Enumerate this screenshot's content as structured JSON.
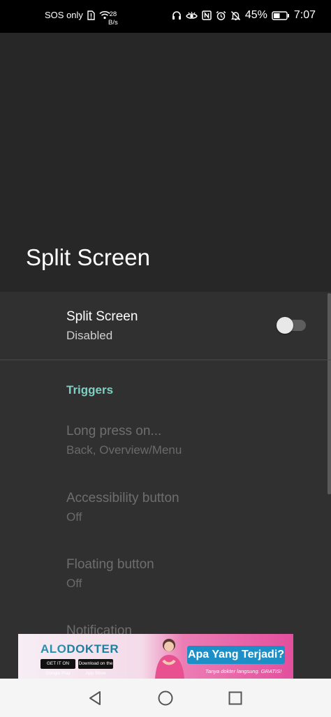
{
  "status_bar": {
    "carrier": "SOS only",
    "net_speed_value": "28",
    "net_speed_unit": "B/s",
    "battery": "45%",
    "time": "7:07",
    "icons": [
      "sim-alert-icon",
      "wifi-icon",
      "headset-icon",
      "eye-comfort-icon",
      "nfc-icon",
      "alarm-icon",
      "mute-icon",
      "battery-icon"
    ]
  },
  "header": {
    "title": "Split Screen"
  },
  "main_setting": {
    "title": "Split Screen",
    "summary": "Disabled",
    "enabled": false
  },
  "section": {
    "title": "Triggers"
  },
  "triggers": [
    {
      "title": "Long press on...",
      "summary": "Back, Overview/Menu"
    },
    {
      "title": "Accessibility button",
      "summary": "Off"
    },
    {
      "title": "Floating button",
      "summary": "Off"
    },
    {
      "title": "Notification",
      "summary": ""
    }
  ],
  "ad": {
    "logo_part1": "ALO",
    "logo_part2": "DOKTER",
    "google_play": "GET IT ON Google Play",
    "app_store": "Download on the App Store",
    "headline": "Apa Yang Terjadi?",
    "tagline": "Tanya dokter langsung. GRATIS!"
  },
  "nav_bar": {
    "buttons": [
      "back-icon",
      "home-icon",
      "recents-icon"
    ]
  },
  "colors": {
    "accent": "#7fcfc2",
    "header_bg": "#272727",
    "list_bg": "#303030"
  }
}
